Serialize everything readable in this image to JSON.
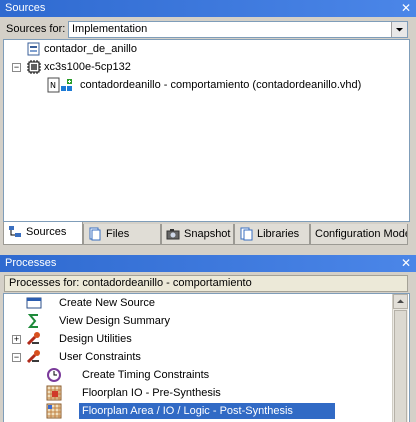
{
  "sources_panel": {
    "title": "Sources",
    "sources_for_label": "Sources for:",
    "sources_for_value": "Implementation",
    "tree": [
      {
        "label": "contador_de_anillo",
        "icon": "project-icon"
      },
      {
        "label": "xc3s100e-5cp132",
        "icon": "chip-icon"
      },
      {
        "label": "contadordeanillo - comportamiento (contadordeanillo.vhd)",
        "icon": "vhdl-file-icon"
      }
    ],
    "tabs": [
      {
        "label": "Sources"
      },
      {
        "label": "Files"
      },
      {
        "label": "Snapshot"
      },
      {
        "label": "Libraries"
      },
      {
        "label": "Configuration Mode"
      }
    ]
  },
  "processes_panel": {
    "title": "Processes",
    "processes_for": "Processes for: contadordeanillo - comportamiento",
    "items": [
      {
        "label": "Create New Source"
      },
      {
        "label": "View Design Summary"
      },
      {
        "label": "Design Utilities"
      },
      {
        "label": "User Constraints"
      },
      {
        "label": "Create Timing Constraints"
      },
      {
        "label": "Floorplan IO - Pre-Synthesis"
      },
      {
        "label": "Floorplan Area / IO / Logic - Post-Synthesis"
      }
    ]
  },
  "colors": {
    "title_bar": "#2f6ad0",
    "selection": "#316ac5",
    "window_bg": "#d4d0c8"
  }
}
